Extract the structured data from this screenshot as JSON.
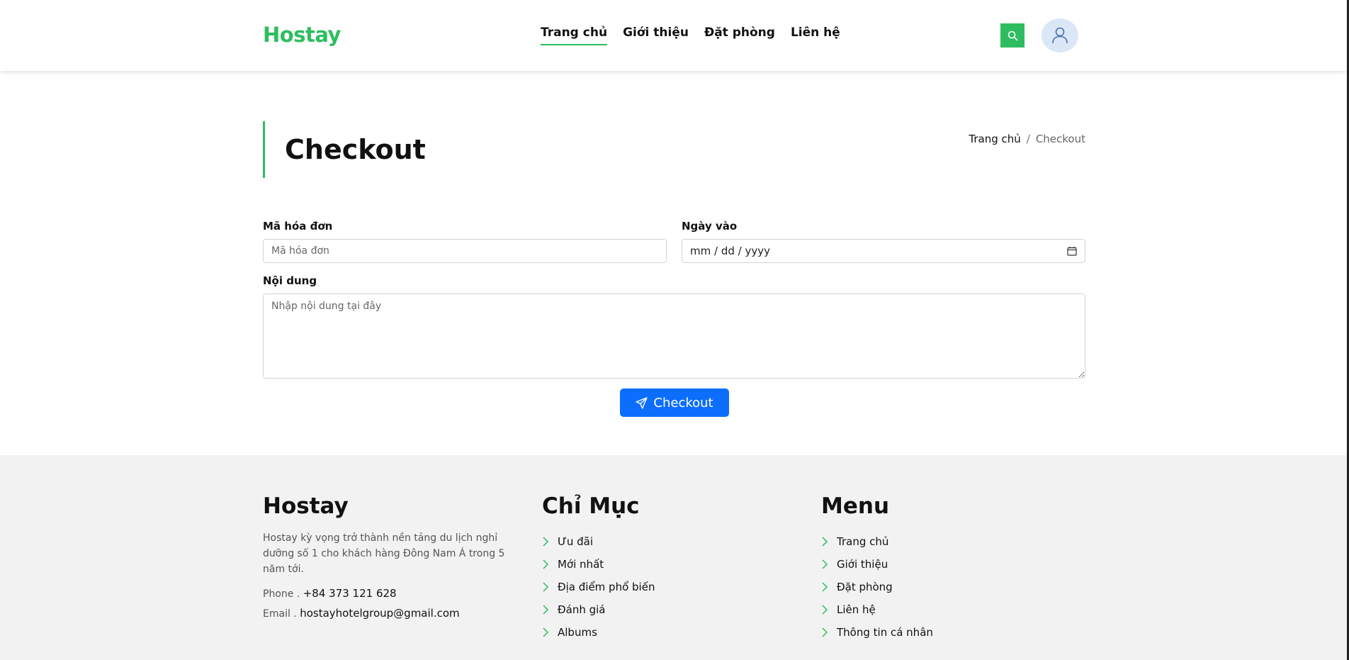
{
  "header": {
    "logo": "Hostay",
    "nav": [
      {
        "label": "Trang chủ",
        "active": true
      },
      {
        "label": "Giới thiệu",
        "active": false
      },
      {
        "label": "Đặt phòng",
        "active": false
      },
      {
        "label": "Liên hệ",
        "active": false
      }
    ],
    "search_icon": "search-icon",
    "avatar_icon": "user-icon"
  },
  "page": {
    "title": "Checkout",
    "breadcrumb": {
      "home": "Trang chủ",
      "separator": "/",
      "current": "Checkout"
    }
  },
  "form": {
    "invoice_label": "Mã hóa đơn",
    "invoice_placeholder": "Mã hóa đơn",
    "date_label": "Ngày vào",
    "date_placeholder": "mm / dd / yyyy",
    "content_label": "Nội dung",
    "content_placeholder": "Nhập nội dung tại đây",
    "submit_label": "Checkout"
  },
  "footer": {
    "brand": {
      "heading": "Hostay",
      "description": "Hostay kỳ vọng trở thành nền tảng du lịch nghỉ dưỡng số 1 cho khách hàng Đông Nam Á trong 5 năm tới.",
      "phone_label": "Phone .",
      "phone": "+84 373 121 628",
      "email_label": "Email .",
      "email": "hostayhotelgroup@gmail.com"
    },
    "index": {
      "heading": "Chỉ Mục",
      "items": [
        "Ưu đãi",
        "Mới nhất",
        "Địa điểm phổ biến",
        "Đánh giá",
        "Albums"
      ]
    },
    "menu": {
      "heading": "Menu",
      "items": [
        "Trang chủ",
        "Giới thiệu",
        "Đặt phòng",
        "Liên hệ",
        "Thông tin cá nhân"
      ]
    }
  },
  "colors": {
    "brand_green": "#2dbd5f",
    "primary_blue": "#0d6efd",
    "footer_bg": "#f2f2f2"
  }
}
